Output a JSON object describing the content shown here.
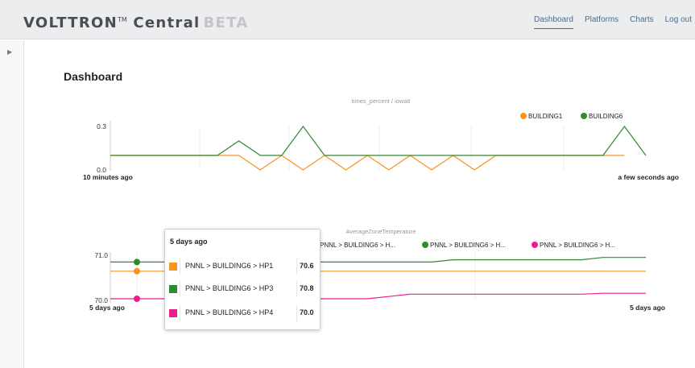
{
  "app": {
    "title": "VOLTTRON",
    "tm": "TM",
    "title2": "Central",
    "beta": "BETA"
  },
  "nav": [
    {
      "label": "Dashboard",
      "active": true
    },
    {
      "label": "Platforms",
      "active": false
    },
    {
      "label": "Charts",
      "active": false
    },
    {
      "label": "Log out",
      "active": false
    }
  ],
  "sidebar": {
    "toggle_icon": "triangle-right-icon"
  },
  "page": {
    "title": "Dashboard"
  },
  "colors": {
    "orange": "#f7941d",
    "green": "#2e8b2e",
    "pink": "#ec1e8c",
    "light_orange": "#fbe0b8"
  },
  "chart_data": [
    {
      "type": "line",
      "title": "times_percent / iowait",
      "x_start_label": "10 minutes ago",
      "x_end_label": "a few seconds ago",
      "y_ticks": [
        "0.3",
        "0.0"
      ],
      "ylim": [
        0,
        0.3
      ],
      "legend": [
        "BUILDING1",
        "BUILDING6"
      ],
      "series": [
        {
          "name": "BUILDING1",
          "color": "#f7941d",
          "values": [
            0.1,
            0.1,
            0.1,
            0.1,
            0.1,
            0.1,
            0.1,
            0.0,
            0.1,
            0.0,
            0.1,
            0.0,
            0.1,
            0.0,
            0.1,
            0.0,
            0.1,
            0.0,
            0.1,
            0.1,
            0.1,
            0.1,
            0.1,
            0.1,
            0.1,
            0.1
          ]
        },
        {
          "name": "BUILDING6",
          "color": "#2e8b2e",
          "values": [
            0.1,
            0.1,
            0.1,
            0.1,
            0.1,
            0.1,
            0.2,
            0.1,
            0.1,
            0.3,
            0.1,
            0.1,
            0.1,
            0.1,
            0.1,
            0.1,
            0.1,
            0.1,
            0.1,
            0.1,
            0.1,
            0.1,
            0.1,
            0.1,
            0.3,
            0.1
          ]
        }
      ]
    },
    {
      "type": "line",
      "title": "AverageZoneTemperature",
      "x_start_label": "5 days ago",
      "x_end_label": "5 days ago",
      "y_ticks": [
        "71.0",
        "70.0"
      ],
      "ylim": [
        70,
        71
      ],
      "legend": [
        "PNNL > BUILDING6 > H...",
        "PNNL > BUILDING6 > H...",
        "PNNL > BUILDING6 > H..."
      ],
      "series": [
        {
          "name": "PNNL > BUILDING6 > HP1",
          "color": "#f7941d",
          "values": [
            70.6,
            70.6,
            70.6,
            70.6,
            70.6,
            70.6,
            70.6,
            70.6,
            70.6,
            70.6,
            70.6,
            70.6,
            70.6,
            70.6,
            70.6,
            70.6,
            70.6,
            70.6,
            70.6,
            70.6,
            70.6,
            70.6,
            70.6,
            70.6,
            70.6,
            70.6
          ]
        },
        {
          "name": "PNNL > BUILDING6 > HP3",
          "color": "#2e8b2e",
          "values": [
            70.8,
            70.8,
            70.8,
            70.8,
            70.8,
            70.8,
            70.8,
            70.8,
            70.8,
            70.8,
            70.8,
            70.8,
            70.8,
            70.8,
            70.8,
            70.8,
            70.85,
            70.85,
            70.85,
            70.85,
            70.85,
            70.85,
            70.85,
            70.9,
            70.9,
            70.9
          ]
        },
        {
          "name": "PNNL > BUILDING6 > HP4",
          "color": "#ec1e8c",
          "values": [
            70.0,
            70.0,
            70.0,
            70.0,
            70.0,
            70.0,
            70.0,
            70.0,
            70.0,
            70.0,
            70.0,
            70.0,
            70.0,
            70.05,
            70.1,
            70.1,
            70.1,
            70.1,
            70.1,
            70.1,
            70.1,
            70.1,
            70.1,
            70.12,
            70.12,
            70.12
          ]
        }
      ]
    }
  ],
  "tooltip": {
    "header": "5 days ago",
    "rows": [
      {
        "name": "PNNL > BUILDING6 > HP1",
        "value": "70.6",
        "color": "#f7941d"
      },
      {
        "name": "PNNL > BUILDING6 > HP3",
        "value": "70.8",
        "color": "#2e8b2e"
      },
      {
        "name": "PNNL > BUILDING6 > HP4",
        "value": "70.0",
        "color": "#ec1e8c"
      }
    ]
  }
}
